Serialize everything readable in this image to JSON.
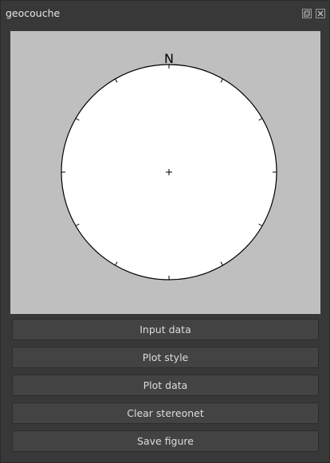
{
  "window": {
    "title": "geocouche",
    "float_icon": "float-icon",
    "close_icon": "close-icon"
  },
  "stereonet": {
    "north_label": "N",
    "background_color": "#bfbfbf",
    "net_color": "#ffffff"
  },
  "buttons": {
    "input_data": "Input data",
    "plot_style": "Plot style",
    "plot_data": "Plot data",
    "clear_stereonet": "Clear stereonet",
    "save_figure": "Save figure"
  }
}
